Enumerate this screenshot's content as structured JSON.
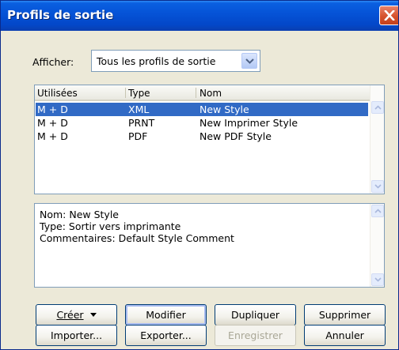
{
  "window": {
    "title": "Profils de sortie",
    "close_icon": "close-icon"
  },
  "filter": {
    "label": "Afficher:",
    "selected": "Tous les profils de sortie",
    "arrow_icon": "chevron-down-icon"
  },
  "list": {
    "columns": [
      "Utilisées",
      "Type",
      "Nom"
    ],
    "rows": [
      {
        "used": "M + D",
        "type": "XML",
        "name": "New  Style",
        "selected": true
      },
      {
        "used": "M + D",
        "type": "PRNT",
        "name": "New Imprimer Style",
        "selected": false
      },
      {
        "used": "M + D",
        "type": "PDF",
        "name": "New PDF Style",
        "selected": false
      }
    ]
  },
  "details": {
    "lines": [
      "Nom: New  Style",
      "Type: Sortir vers imprimante",
      "Commentaires: Default Style Comment"
    ]
  },
  "buttons": {
    "creer": "Créer",
    "modifier": "Modifier",
    "dupliquer": "Dupliquer",
    "supprimer": "Supprimer",
    "importer": "Importer...",
    "exporter": "Exporter...",
    "enregistrer": "Enregistrer",
    "annuler": "Annuler"
  },
  "colors": {
    "titlebar": "#0552d6",
    "selection": "#316ac5",
    "dialog_bg": "#ece9d8"
  }
}
